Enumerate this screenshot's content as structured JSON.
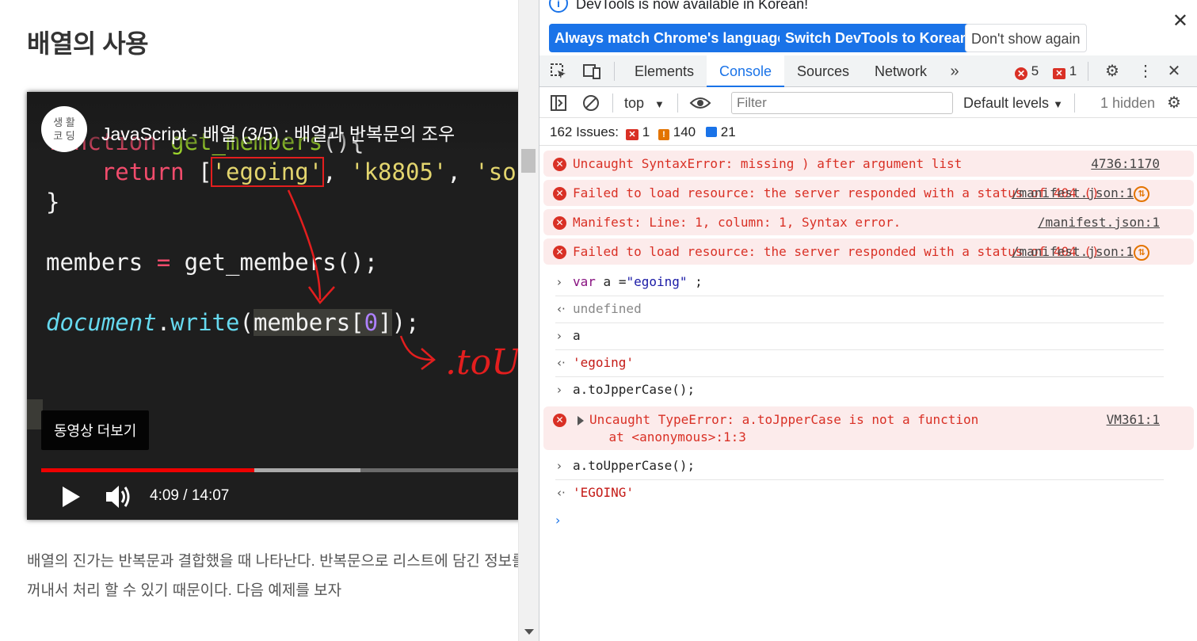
{
  "page": {
    "title": "배열의 사용",
    "body_text": "배열의 진가는 반복문과 결합했을 때 나타난다. 반복문으로 리스트에 담긴 정보를 하나씩 꺼내서 처리 할 수 있기 때문이다. 다음 예제를 보자"
  },
  "video": {
    "channel_logo_text": "생 활\n코 딩",
    "title": "JavaScript - 배열 (3/5) : 배열과 반복문의 조우",
    "code_lines": {
      "l1_a": "function ",
      "l1_b": "get_members",
      "l1_c": "(){",
      "l2_a": "    return ",
      "l2_b": "[",
      "l2_c": "'egoing'",
      "l2_d": ", ",
      "l2_e": "'k8805'",
      "l2_f": ", ",
      "l2_g": "'sorialgi'",
      "l2_h": "];",
      "l3": "}",
      "l4_a": "members ",
      "l4_b": "=",
      "l4_c": " get_members();",
      "l5_a": "document",
      "l5_b": ".",
      "l5_c": "write",
      "l5_d": "(",
      "l5_e": "members[",
      "l5_f": "0",
      "l5_g": "]",
      "l5_h": ");",
      "annotation": ".toUp"
    },
    "more_button": "동영상 더보기",
    "current_time": "4:09",
    "duration": "14:07",
    "time_display": "4:09 / 14:07",
    "played_fraction": 0.42,
    "buffered_fraction": 0.63
  },
  "devtools": {
    "infobar": {
      "message": "DevTools is now available in Korean!",
      "btn_match": "Always match Chrome's language",
      "btn_switch": "Switch DevTools to Korean",
      "btn_dont_show": "Don't show again"
    },
    "tabs": [
      "Elements",
      "Console",
      "Sources",
      "Network"
    ],
    "active_tab": "Console",
    "error_count": "5",
    "warning_count": "1",
    "toolbar": {
      "context": "top",
      "filter_placeholder": "Filter",
      "levels": "Default levels",
      "hidden": "1 hidden"
    },
    "issues": {
      "label": "162 Issues:",
      "errors": "1",
      "warnings": "140",
      "info": "21"
    },
    "messages": [
      {
        "type": "error",
        "text": "Uncaught SyntaxError: missing ) after argument list",
        "source": "4736:1170"
      },
      {
        "type": "error",
        "text": "Failed to load resource: the server responded with a status of 404 ()",
        "source": "/manifest.json:1",
        "flag": true
      },
      {
        "type": "error",
        "text": "Manifest: Line: 1, column: 1, Syntax error.",
        "source": "/manifest.json:1"
      },
      {
        "type": "error",
        "text": "Failed to load resource: the server responded with a status of 404 ()",
        "source": "/manifest.json:1",
        "flag": true
      },
      {
        "type": "input",
        "text": "var a =\"egoing\" ;"
      },
      {
        "type": "output",
        "text": "undefined"
      },
      {
        "type": "input",
        "text": "a"
      },
      {
        "type": "output-str",
        "text": "'egoing'"
      },
      {
        "type": "input",
        "text": "a.toJpperCase();"
      },
      {
        "type": "error-expand",
        "text": "Uncaught TypeError: a.toJpperCase is not a function",
        "text2": "    at <anonymous>:1:3",
        "source": "VM361:1"
      },
      {
        "type": "input",
        "text": "a.toUpperCase();"
      },
      {
        "type": "output-str",
        "text": "'EGOING'"
      }
    ],
    "colors": {
      "accent": "#1a73e8",
      "error": "#d93025",
      "error_bg": "#fcebeb",
      "warning": "#e37400"
    }
  }
}
